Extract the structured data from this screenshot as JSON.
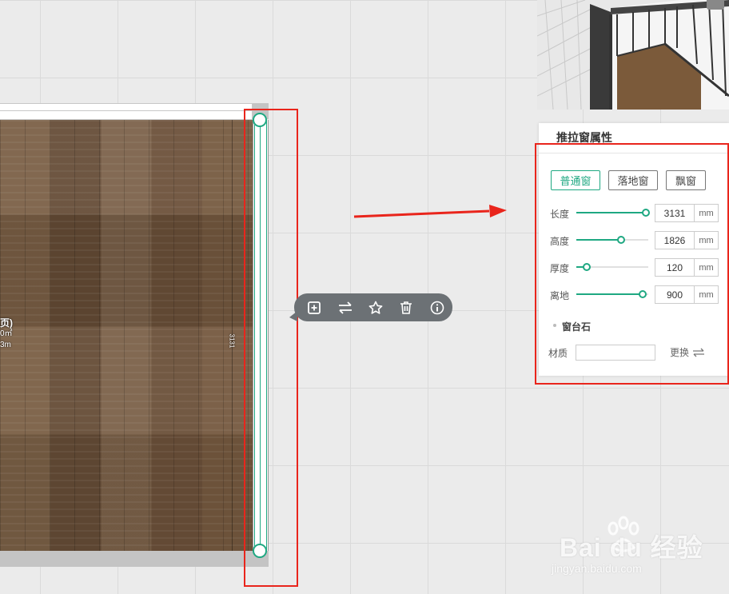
{
  "canvas": {
    "room_label_lines": [
      "页)",
      "0㎡",
      "3m"
    ],
    "window_dimension": "3131"
  },
  "floating_toolbar": {
    "buttons": [
      {
        "icon": "add-box-icon"
      },
      {
        "icon": "swap-icon"
      },
      {
        "icon": "star-icon"
      },
      {
        "icon": "trash-icon"
      },
      {
        "icon": "info-icon"
      }
    ]
  },
  "panel": {
    "title": "推拉窗属性",
    "window_types": [
      {
        "label": "普通窗",
        "active": true
      },
      {
        "label": "落地窗",
        "active": false
      },
      {
        "label": "飘窗",
        "active": false
      }
    ],
    "rows": [
      {
        "label": "长度",
        "value": "3131",
        "unit": "mm",
        "slider_fraction": 0.97
      },
      {
        "label": "高度",
        "value": "1826",
        "unit": "mm",
        "slider_fraction": 0.62
      },
      {
        "label": "厚度",
        "value": "120",
        "unit": "mm",
        "slider_fraction": 0.14
      },
      {
        "label": "离地",
        "value": "900",
        "unit": "mm",
        "slider_fraction": 0.92
      }
    ],
    "sill": {
      "title": "窗台石",
      "material_label": "材质",
      "replace_label": "更换"
    }
  },
  "watermark": {
    "logo": "Bai du 经验",
    "url": "jingyan.baidu.com"
  },
  "colors": {
    "accent": "#1fa882",
    "highlight_red": "#e9251c"
  }
}
